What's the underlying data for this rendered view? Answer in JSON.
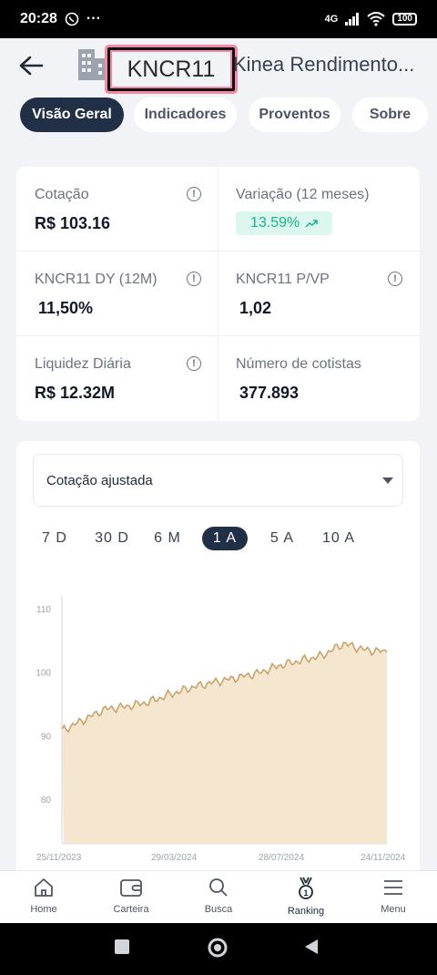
{
  "status_bar": {
    "time": "20:28",
    "dots": "···",
    "network": "4G",
    "battery": "100"
  },
  "header": {
    "ticker": "KNCR11",
    "fund_name": "Kinea Rendimento..."
  },
  "tabs": [
    {
      "label": "Visão Geral",
      "active": true
    },
    {
      "label": "Indicadores",
      "active": false
    },
    {
      "label": "Proventos",
      "active": false
    },
    {
      "label": "Sobre",
      "active": false
    }
  ],
  "indicators": [
    {
      "label": "Cotação",
      "value": "R$ 103.16",
      "info": true
    },
    {
      "label": "Variação (12 meses)",
      "value": "13.59%",
      "badge": true
    },
    {
      "label": "KNCR11 DY (12M)",
      "value": "11,50%",
      "info": true
    },
    {
      "label": "KNCR11 P/VP",
      "value": "1,02",
      "info": true
    },
    {
      "label": "Liquidez Diária",
      "value": "R$ 12.32M",
      "info": true
    },
    {
      "label": "Número de cotistas",
      "value": "377.893"
    }
  ],
  "chart_controls": {
    "select_value": "Cotação ajustada",
    "ranges": [
      "7 D",
      "30 D",
      "6 M",
      "1 A",
      "5 A",
      "10 A"
    ],
    "active_range": "1 A"
  },
  "chart_data": {
    "type": "area",
    "x": [
      "25/11/2023",
      "21/12/2023",
      "16/01/2024",
      "11/02/2024",
      "08/03/2024",
      "29/03/2024",
      "24/04/2024",
      "20/05/2024",
      "15/06/2024",
      "11/07/2024",
      "28/07/2024",
      "23/08/2024",
      "18/09/2024",
      "14/10/2024",
      "09/11/2024",
      "24/11/2024"
    ],
    "values": [
      90.8,
      92.5,
      94.2,
      94.6,
      95.3,
      96.5,
      97.6,
      98.4,
      99.1,
      99.8,
      101.0,
      101.8,
      102.6,
      104.5,
      103.5,
      103.2
    ],
    "xticks": [
      "25/11/2023",
      "29/03/2024",
      "28/07/2024",
      "24/11/2024"
    ],
    "yticks": [
      80,
      90,
      100,
      110
    ],
    "ylim": [
      73,
      112
    ],
    "color": "#c8a36c",
    "fill": "#f5e6cf",
    "grid": false
  },
  "bottom_nav": [
    {
      "label": "Home",
      "icon": "home-icon"
    },
    {
      "label": "Carteira",
      "icon": "wallet-icon"
    },
    {
      "label": "Busca",
      "icon": "search-icon"
    },
    {
      "label": "Ranking",
      "icon": "medal-icon",
      "active": true
    },
    {
      "label": "Menu",
      "icon": "menu-icon"
    }
  ]
}
